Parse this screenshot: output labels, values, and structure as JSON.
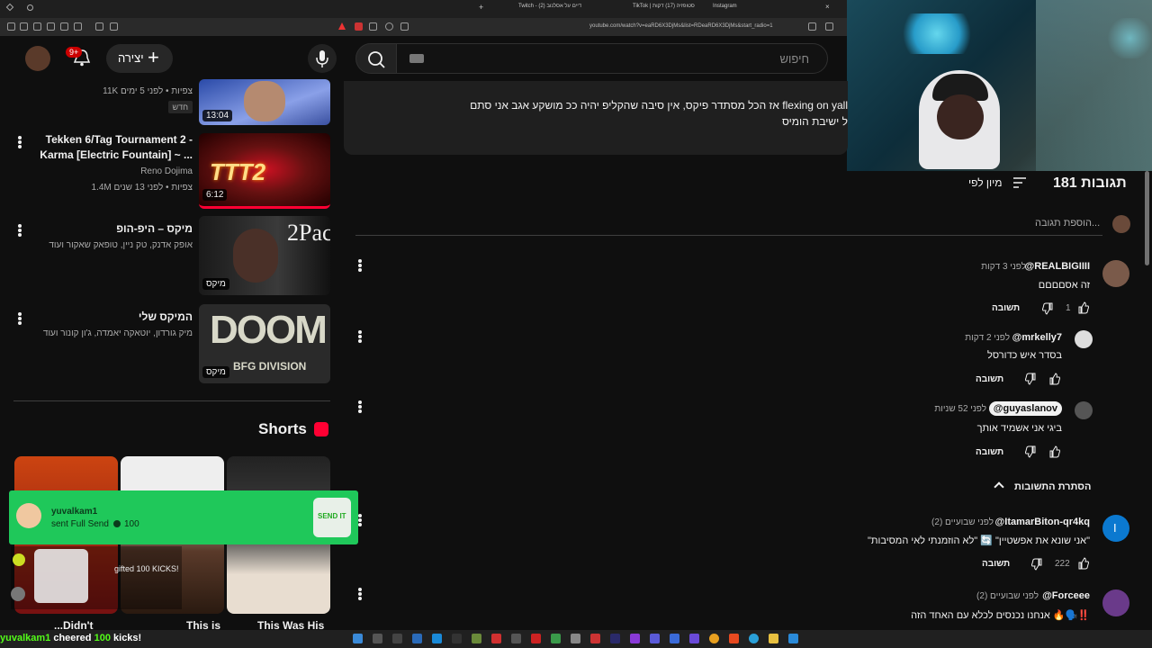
{
  "browser": {
    "tabs": [
      "Twitch - (2) דיים על אסלנוב",
      "TikTok | סטופזיה (17) דקות",
      "Instagram"
    ],
    "url": "youtube.com/watch?v=eaRD6X3DjMs&list=RDeaRD6X3DjMs&start_radio=1"
  },
  "header": {
    "search_placeholder": "חיפוש",
    "create_label": "יצירה",
    "notif_count": "9+"
  },
  "video_list": [
    {
      "meta1": "11K צפיות • לפני 5 ימים",
      "badge": "חדש",
      "duration": "13:04"
    },
    {
      "title_line1": "Tekken 6/Tag Tournament 2 -",
      "title_line2": "Karma [Electric Fountain] ~ ...",
      "channel": "Reno Dojima",
      "meta": "1.4M צפיות • לפני 13 שנים",
      "duration": "6:12"
    },
    {
      "title": "מיקס – היפ-הופ",
      "meta": "אופק אדנק, טק ניין, טופאק שאקור ועוד",
      "duration": "מיקס",
      "thumb_text": "2Pac"
    },
    {
      "title": "המיקס שלי",
      "meta": "מיק גורדון, יוטאקה יאמדה, ג'ון קונור ועוד",
      "duration": "מיקס",
      "thumb_text": "DOOM",
      "thumb_sub": "BFG DIVISION"
    }
  ],
  "shorts": {
    "label": "Shorts",
    "captions": [
      "...Didn't",
      "This is",
      "This Was His"
    ]
  },
  "description": {
    "line1": "אז הכל מסתדר פיקס, אין סיבה שהקליפ יהיה ככ מושקע אגב אני סתם flexing on yall",
    "line2": "ל ישיבת הומיס"
  },
  "comments_header": {
    "count": "181 תגובות",
    "sort": "מיון לפי",
    "add_placeholder": "הוספת תגובה..."
  },
  "comments": [
    {
      "name": "@REALBIGIIII",
      "time": "לפני 3 דקות",
      "text": "זה אסםםםם",
      "likes": "1",
      "reply": "תשובה"
    },
    {
      "name": "@mrkelly7",
      "time": "לפני 2 דקות",
      "text": "בסדר איש כדורסל",
      "likes": "",
      "reply": "תשובה"
    },
    {
      "name": "@guyaslanov",
      "time": "לפני 52 שניות",
      "text": "ביגי אני אשמיד אותך",
      "likes": "",
      "reply": "תשובה"
    },
    {
      "name": "@ItamarBiton-qr4kq",
      "time": "לפני שבועיים (2)",
      "text": "\"אני שונא את אפשטיין\" 🔄 \"לא הוזמנתי לאי המסיבות\"",
      "likes": "222",
      "reply": "תשובה"
    },
    {
      "name": "@Forceee",
      "time": "לפני שבועיים (2)",
      "text": "אנחנו נכנסים לכלא עם האחד הזה 🔥🗣️‼️",
      "likes": "",
      "reply": ""
    }
  ],
  "hide_replies": "הסתרת התשובות",
  "alert": {
    "user": "yuvalkam1",
    "action": "sent Full Send",
    "amount": "100",
    "item": "SEND IT"
  },
  "chat": {
    "line1": "gifted 100 KICKS!",
    "bottom_user": "yuvalkam1",
    "bottom_text": "cheered",
    "bottom_amount": "100",
    "bottom_suffix": "kicks!"
  },
  "colors": {
    "bg": "#0f0f0f",
    "alert_green": "#1fc85a",
    "red": "#ff0033",
    "accent_blue": "#3ea6ff"
  }
}
